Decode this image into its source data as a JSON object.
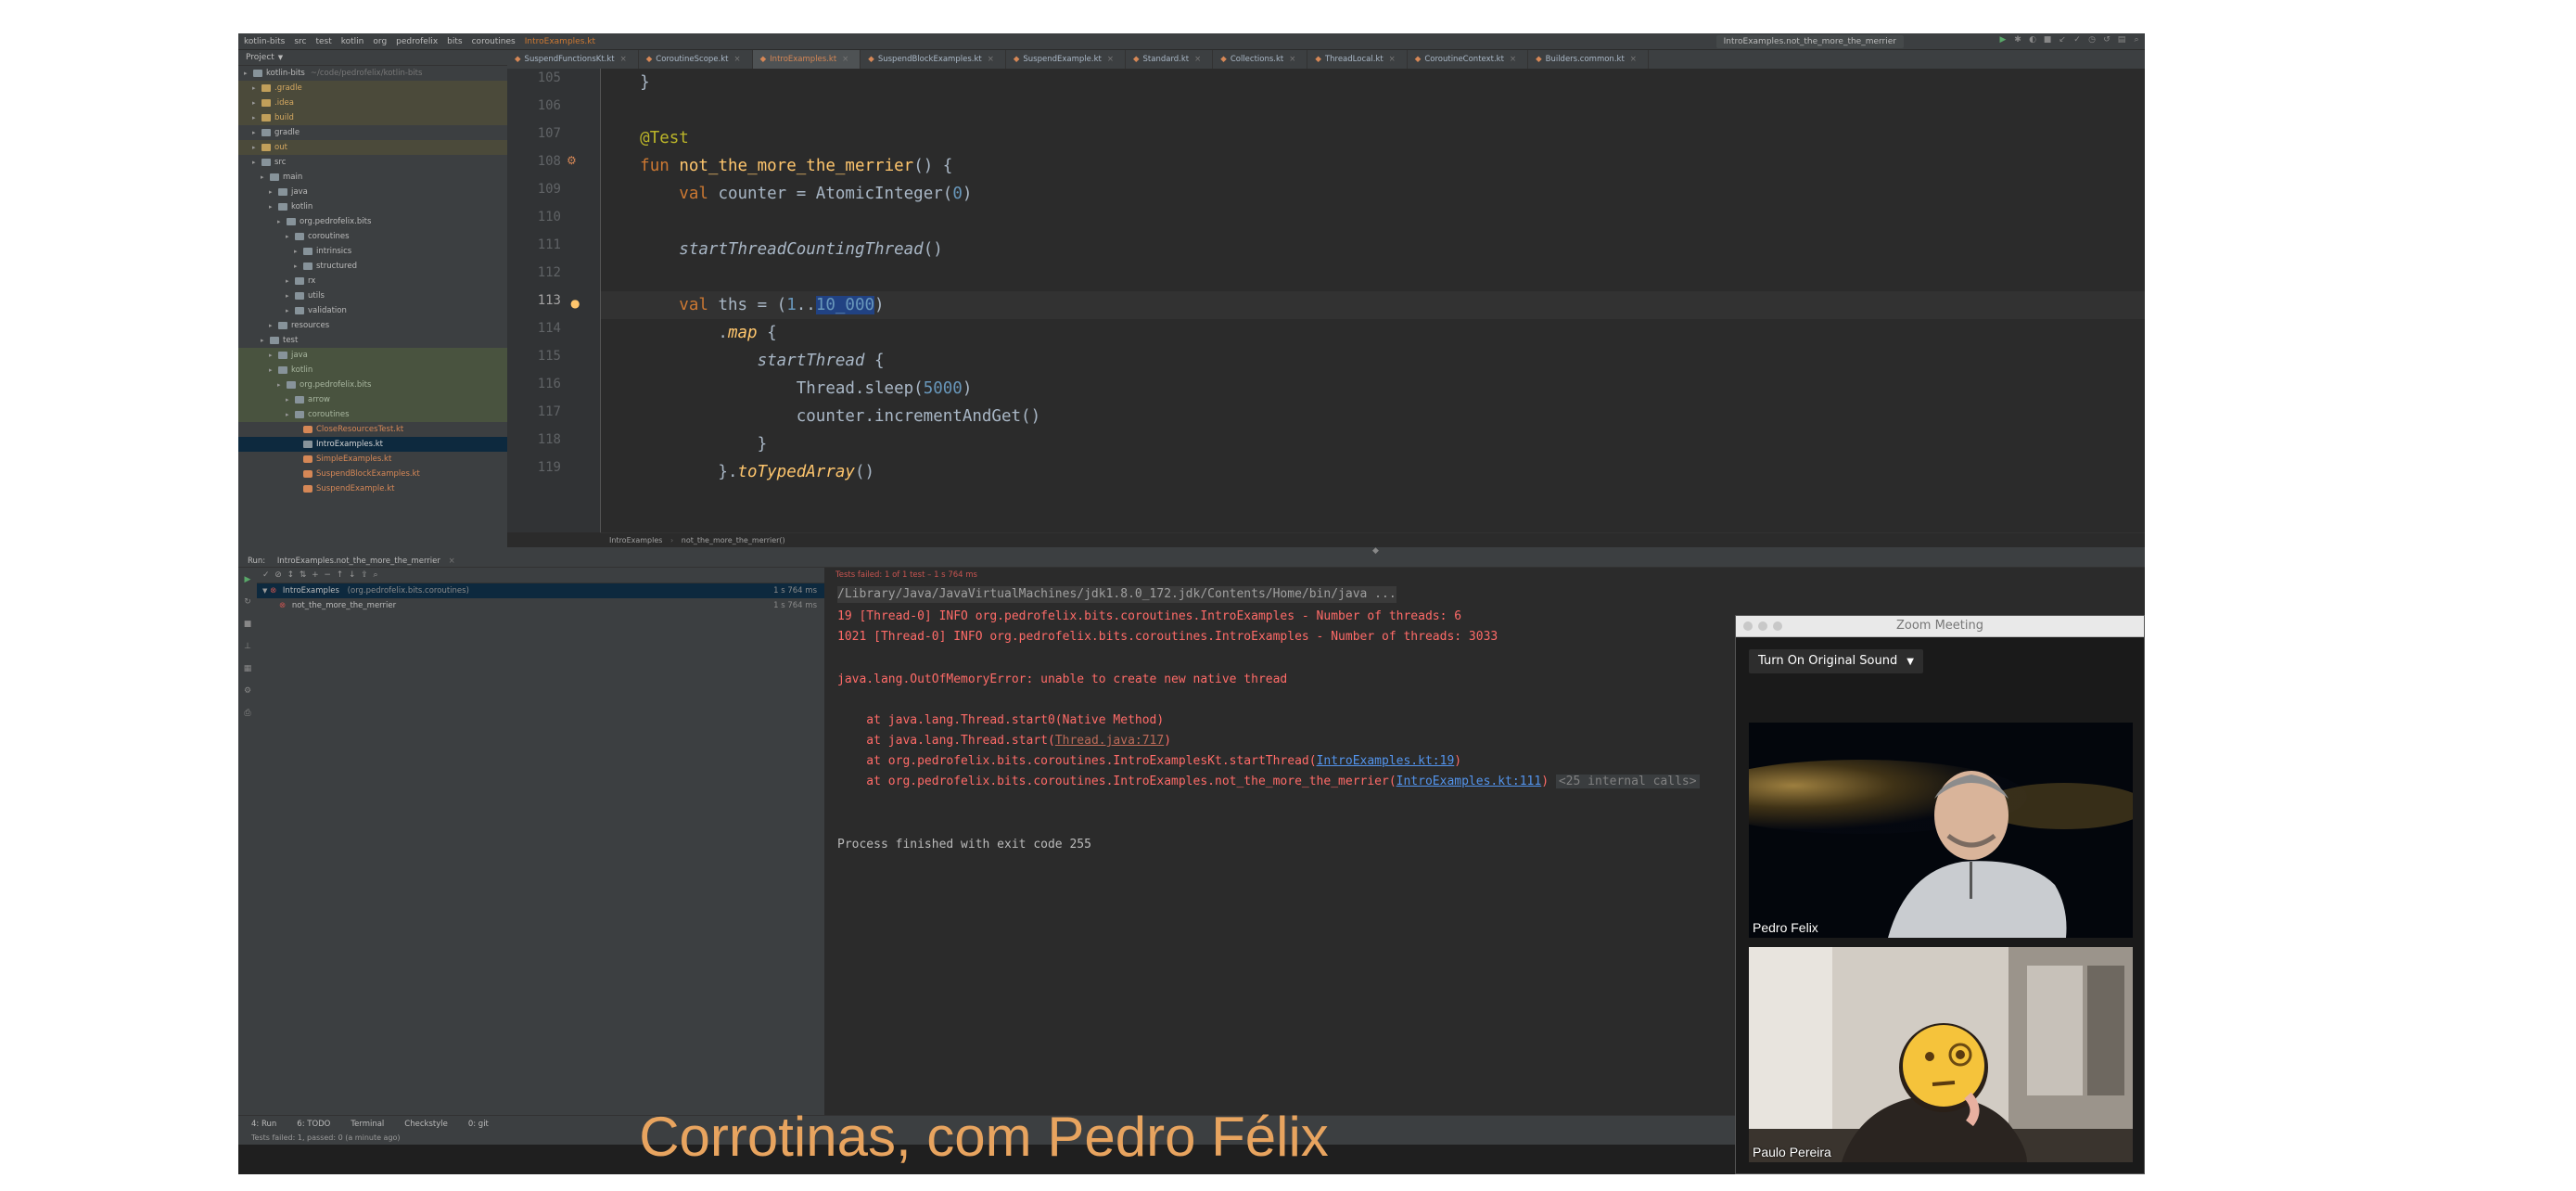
{
  "navbar": {
    "crumbs": [
      "kotlin-bits",
      "src",
      "test",
      "kotlin",
      "org",
      "pedrofelix",
      "bits",
      "coroutines",
      "IntroExamples.kt"
    ],
    "run_config": "IntroExamples.not_the_more_the_merrier"
  },
  "project": {
    "header": "Project",
    "items": [
      {
        "label": "kotlin-bits",
        "path": "~/code/pedrofelix/kotlin-bits",
        "indent": 0,
        "kind": "root"
      },
      {
        "label": ".gradle",
        "indent": 1,
        "kind": "excluded"
      },
      {
        "label": ".idea",
        "indent": 1,
        "kind": "excluded"
      },
      {
        "label": "build",
        "indent": 1,
        "kind": "excluded"
      },
      {
        "label": "gradle",
        "indent": 1,
        "kind": "folder"
      },
      {
        "label": "out",
        "indent": 1,
        "kind": "excluded"
      },
      {
        "label": "src",
        "indent": 1,
        "kind": "folder"
      },
      {
        "label": "main",
        "indent": 2,
        "kind": "folder"
      },
      {
        "label": "java",
        "indent": 3,
        "kind": "folder"
      },
      {
        "label": "kotlin",
        "indent": 3,
        "kind": "folder"
      },
      {
        "label": "org.pedrofelix.bits",
        "indent": 4,
        "kind": "folder"
      },
      {
        "label": "coroutines",
        "indent": 5,
        "kind": "folder"
      },
      {
        "label": "intrinsics",
        "indent": 6,
        "kind": "folder"
      },
      {
        "label": "structured",
        "indent": 6,
        "kind": "folder"
      },
      {
        "label": "rx",
        "indent": 5,
        "kind": "folder"
      },
      {
        "label": "utils",
        "indent": 5,
        "kind": "folder"
      },
      {
        "label": "validation",
        "indent": 5,
        "kind": "folder"
      },
      {
        "label": "resources",
        "indent": 3,
        "kind": "folder"
      },
      {
        "label": "test",
        "indent": 2,
        "kind": "folder"
      },
      {
        "label": "java",
        "indent": 3,
        "kind": "testsrc"
      },
      {
        "label": "kotlin",
        "indent": 3,
        "kind": "testsrc"
      },
      {
        "label": "org.pedrofelix.bits",
        "indent": 4,
        "kind": "testsrc"
      },
      {
        "label": "arrow",
        "indent": 5,
        "kind": "testsrc"
      },
      {
        "label": "coroutines",
        "indent": 5,
        "kind": "testsrc"
      },
      {
        "label": "CloseResourcesTest.kt",
        "indent": 6,
        "kind": "kt"
      },
      {
        "label": "IntroExamples.kt",
        "indent": 6,
        "kind": "selected"
      },
      {
        "label": "SimpleExamples.kt",
        "indent": 6,
        "kind": "kt"
      },
      {
        "label": "SuspendBlockExamples.kt",
        "indent": 6,
        "kind": "kt"
      },
      {
        "label": "SuspendExample.kt",
        "indent": 6,
        "kind": "kt"
      }
    ]
  },
  "editor": {
    "tabs": [
      {
        "label": "SuspendFunctionsKt.kt",
        "active": false
      },
      {
        "label": "CoroutineScope.kt",
        "active": false
      },
      {
        "label": "IntroExamples.kt",
        "active": true
      },
      {
        "label": "SuspendBlockExamples.kt",
        "active": false
      },
      {
        "label": "SuspendExample.kt",
        "active": false
      },
      {
        "label": "Standard.kt",
        "active": false
      },
      {
        "label": "Collections.kt",
        "active": false
      },
      {
        "label": "ThreadLocal.kt",
        "active": false
      },
      {
        "label": "CoroutineContext.kt",
        "active": false
      },
      {
        "label": "Builders.common.kt",
        "active": false
      }
    ],
    "line_numbers": [
      "105",
      "106",
      "107",
      "108",
      "109",
      "110",
      "111",
      "112",
      "113",
      "114",
      "115",
      "116",
      "117",
      "118",
      "119"
    ],
    "current_line": "113",
    "breadcrumb": [
      "IntroExamples",
      "not_the_more_the_merrier()"
    ]
  },
  "run": {
    "header": "Run:",
    "config_tab": "IntroExamples.not_the_more_the_merrier",
    "status": "Tests failed: 1 of 1 test – 1 s 764 ms",
    "tests": [
      {
        "name": "IntroExamples",
        "package": "(org.pedrofelix.bits.coroutines)",
        "time": "1 s 764 ms"
      },
      {
        "name": "not_the_more_the_merrier",
        "package": "",
        "time": "1 s 764 ms"
      }
    ],
    "console": {
      "cmd": "/Library/Java/JavaVirtualMachines/jdk1.8.0_172.jdk/Contents/Home/bin/java ...",
      "log1": "19 [Thread-0] INFO org.pedrofelix.bits.coroutines.IntroExamples - Number of threads: 6",
      "log2": "1021 [Thread-0] INFO org.pedrofelix.bits.coroutines.IntroExamples - Number of threads: 3033",
      "error": "java.lang.OutOfMemoryError: unable to create new native thread",
      "st1": "    at java.lang.Thread.start0(Native Method)",
      "st2_prefix": "    at java.lang.Thread.start(",
      "st2_link": "Thread.java:717",
      "st2_suffix": ")",
      "st3_prefix": "    at org.pedrofelix.bits.coroutines.IntroExamplesKt.startThread(",
      "st3_link": "IntroExamples.kt:19",
      "st3_suffix": ")",
      "st4_prefix": "    at org.pedrofelix.bits.coroutines.IntroExamples.not_the_more_the_merrier(",
      "st4_link": "IntroExamples.kt:111",
      "st4_suffix": ")",
      "st4_internal": "<25 internal calls>",
      "exit": "Process finished with exit code 255"
    }
  },
  "bottom_tabs": [
    "4: Run",
    "6: TODO",
    "Terminal",
    "Checkstyle",
    "0: git"
  ],
  "statusbar": "Tests failed: 1, passed: 0 (a minute ago)",
  "zoom": {
    "title": "Zoom Meeting",
    "sound_button": "Turn On Original Sound",
    "participant1": "Pedro Felix",
    "participant2": "Paulo Pereira"
  },
  "subtitle": "Corrotinas, com Pedro Félix",
  "colors": {
    "keyword": "#cc7832",
    "function": "#ffc66d",
    "number": "#6897bb",
    "annotation": "#bbb529",
    "error": "#ff6b68",
    "subtitle": "#e8a45f"
  }
}
